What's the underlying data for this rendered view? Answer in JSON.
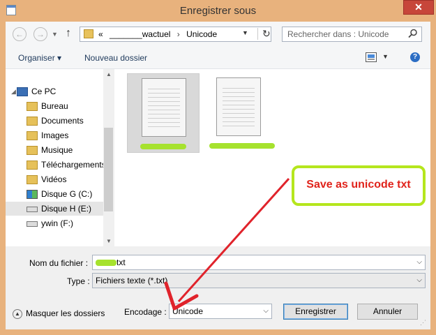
{
  "window": {
    "title": "Enregistrer sous",
    "close_glyph": "✕"
  },
  "address": {
    "path_prefix": "«",
    "path_parent": "_______wactuel",
    "path_separator": "›",
    "path_current": "Unicode",
    "search_placeholder": "Rechercher dans : Unicode"
  },
  "toolbar": {
    "organise_label": "Organiser ▾",
    "new_folder_label": "Nouveau dossier",
    "help_glyph": "?"
  },
  "nav": {
    "items": [
      {
        "label": "Ce PC",
        "icon": "computer-icon"
      },
      {
        "label": "Bureau",
        "icon": "folder-icon"
      },
      {
        "label": "Documents",
        "icon": "folder-icon"
      },
      {
        "label": "Images",
        "icon": "folder-icon"
      },
      {
        "label": "Musique",
        "icon": "folder-icon"
      },
      {
        "label": "Téléchargements",
        "icon": "folder-icon"
      },
      {
        "label": "Vidéos",
        "icon": "folder-icon"
      },
      {
        "label": "Disque G  (C:)",
        "icon": "windows-drive-icon"
      },
      {
        "label": "Disque H (E:)",
        "icon": "drive-icon",
        "selected": true
      },
      {
        "label": "ywin (F:)",
        "icon": "drive-icon"
      }
    ]
  },
  "form": {
    "filename_label": "Nom du fichier :",
    "filename_value": "txt",
    "type_label": "Type :",
    "type_value": "Fichiers texte (*.txt)",
    "encoding_label": "Encodage :",
    "encoding_value": "Unicode",
    "hide_folders_label": "Masquer les dossiers",
    "save_label": "Enregistrer",
    "cancel_label": "Annuler"
  },
  "annotation": {
    "callout_text": "Save as unicode txt"
  },
  "colors": {
    "title_bar": "#e8b27d",
    "close_button": "#c7463a",
    "redaction": "#a6e22e",
    "callout_border": "#b5e61d",
    "callout_text": "#e0231b",
    "arrow": "#e0232b"
  }
}
